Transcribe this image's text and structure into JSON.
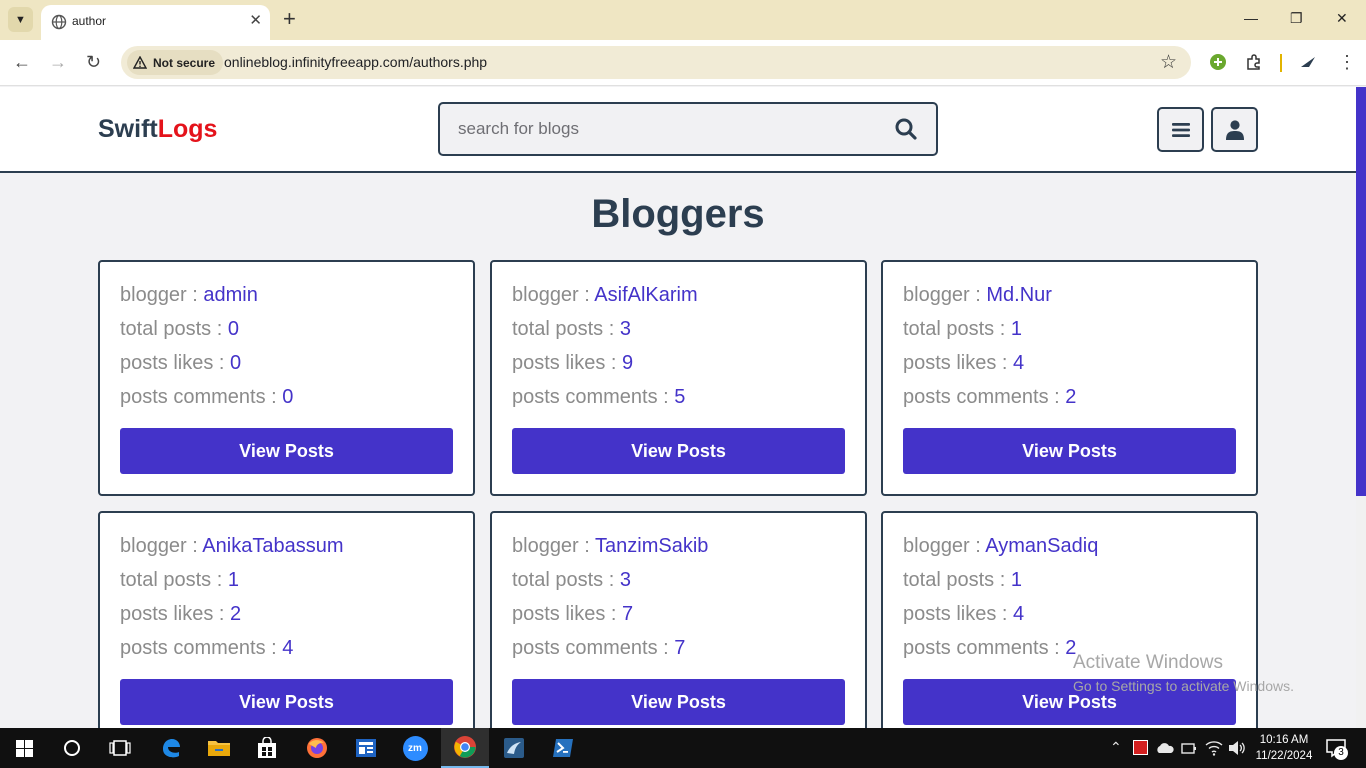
{
  "browser": {
    "tab_title": "author",
    "security_label": "Not secure",
    "url": "onlineblog.infinityfreeapp.com/authors.php"
  },
  "site": {
    "logo_part1": "Swift",
    "logo_part2": "Logs",
    "search_placeholder": "search for blogs"
  },
  "page": {
    "title": "Bloggers",
    "labels": {
      "blogger": "blogger : ",
      "total_posts": "total posts : ",
      "posts_likes": "posts likes : ",
      "posts_comments": "posts comments : "
    },
    "button_label": "View Posts",
    "bloggers": [
      {
        "name": "admin",
        "total_posts": "0",
        "likes": "0",
        "comments": "0"
      },
      {
        "name": "AsifAlKarim",
        "total_posts": "3",
        "likes": "9",
        "comments": "5"
      },
      {
        "name": "Md.Nur",
        "total_posts": "1",
        "likes": "4",
        "comments": "2"
      },
      {
        "name": "AnikaTabassum",
        "total_posts": "1",
        "likes": "2",
        "comments": "4"
      },
      {
        "name": "TanzimSakib",
        "total_posts": "3",
        "likes": "7",
        "comments": "7"
      },
      {
        "name": "AymanSadiq",
        "total_posts": "1",
        "likes": "4",
        "comments": "2"
      }
    ]
  },
  "watermark": {
    "line1": "Activate Windows",
    "line2": "Go to Settings to activate Windows."
  },
  "taskbar": {
    "time": "10:16 AM",
    "date": "11/22/2024",
    "notification_count": "3",
    "zoom_label": "zm"
  },
  "colors": {
    "accent": "#4433c9",
    "heading": "#2c3e50",
    "logo_red": "#e4131b",
    "label_gray": "#8b8b8b"
  }
}
